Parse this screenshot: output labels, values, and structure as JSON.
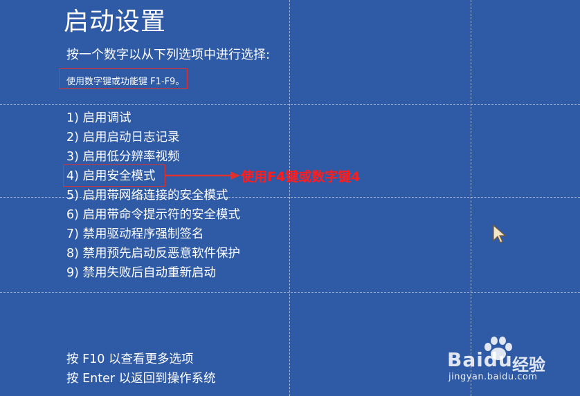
{
  "screen": {
    "title": "启动设置",
    "instruction": "按一个数字以从下列选项中进行选择:",
    "key_hint": "使用数字键或功能键 F1-F9。"
  },
  "options": [
    "1) 启用调试",
    "2) 启用启动日志记录",
    "3) 启用低分辨率视频",
    "4) 启用安全模式",
    "5) 启用带网络连接的安全模式",
    "6) 启用带命令提示符的安全模式",
    "7) 禁用驱动程序强制签名",
    "8) 禁用预先启动反恶意软件保护",
    "9) 禁用失败后自动重新启动"
  ],
  "annotation": {
    "text": "使用F4键或数字键4",
    "color": "#ff1e1e"
  },
  "footer": {
    "more_options": "按 F10 以查看更多选项",
    "return": "按 Enter 以返回到操作系统"
  },
  "watermark": {
    "brand": "Baidu",
    "jingyan": "经验",
    "url": "jingyan.baidu.com"
  },
  "colors": {
    "background": "#2e5aa6",
    "highlight_border": "#e03030",
    "text": "#ffffff"
  }
}
